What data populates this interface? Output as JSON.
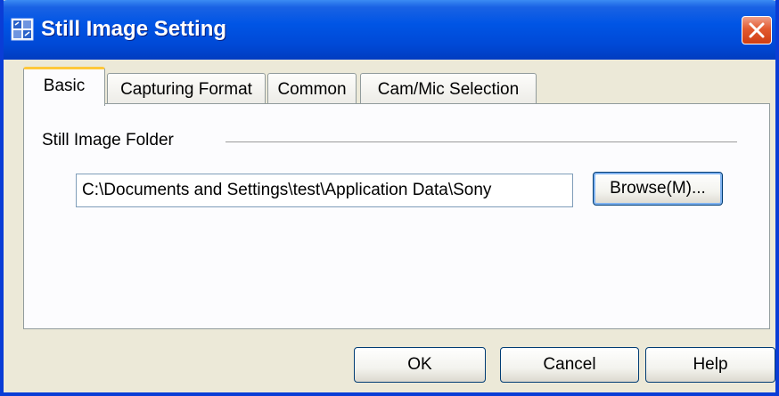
{
  "window": {
    "title": "Still Image Setting",
    "app_icon": "app-icon",
    "close_icon": "close-icon"
  },
  "tabs": [
    {
      "label": "Basic",
      "active": true
    },
    {
      "label": "Capturing Format",
      "active": false
    },
    {
      "label": "Common",
      "active": false
    },
    {
      "label": "Cam/Mic Selection",
      "active": false
    }
  ],
  "basic": {
    "group_label": "Still Image Folder",
    "folder_path": "C:\\Documents and Settings\\test\\Application Data\\Sony",
    "browse_label": "Browse(M)..."
  },
  "buttons": {
    "ok": "OK",
    "cancel": "Cancel",
    "help": "Help"
  },
  "colors": {
    "titlebar": "#0055e5",
    "close": "#e25a2f",
    "active_tab_accent": "#ffc83c",
    "dialog_bg": "#ece9d8"
  }
}
